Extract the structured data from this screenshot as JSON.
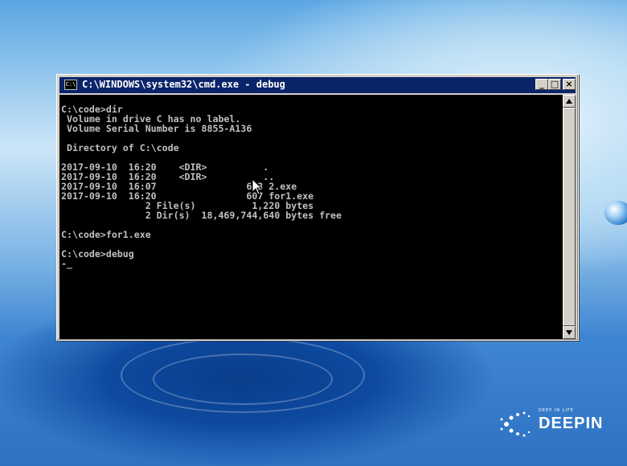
{
  "window": {
    "title": "C:\\WINDOWS\\system32\\cmd.exe - debug",
    "icon_text": "C:\\",
    "minimize_glyph": "_",
    "maximize_glyph": "□",
    "close_glyph": "×"
  },
  "console": {
    "lines": [
      "C:\\code>dir",
      " Volume in drive C has no label.",
      " Volume Serial Number is 8855-A136",
      "",
      " Directory of C:\\code",
      "",
      "2017-09-10  16:20    <DIR>          .",
      "2017-09-10  16:20    <DIR>          ..",
      "2017-09-10  16:07                613 2.exe",
      "2017-09-10  16:20                607 for1.exe",
      "               2 File(s)          1,220 bytes",
      "               2 Dir(s)  18,469,744,640 bytes free",
      "",
      "C:\\code>for1.exe",
      "",
      "C:\\code>debug",
      "-_"
    ]
  },
  "desktop": {
    "logo_tagline": "DEEP IN LIFE",
    "logo_name": "DEEPIN"
  },
  "icons": {
    "cmd": "cmd-icon",
    "cursor": "mouse-pointer-icon",
    "logo": "deepin-logo-icon"
  }
}
